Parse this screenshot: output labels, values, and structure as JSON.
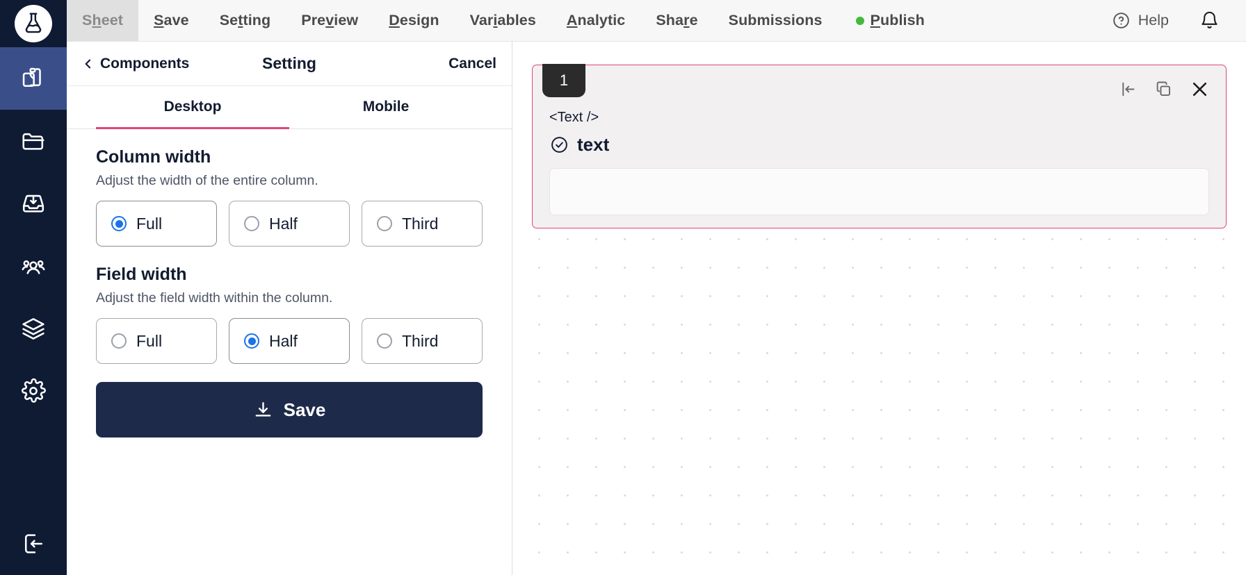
{
  "brand": {
    "logo_icon": "flask-logo-icon"
  },
  "sidebar": {
    "items": [
      {
        "name": "clipboard",
        "icon": "clipboard-icon",
        "active": true
      },
      {
        "name": "folder",
        "icon": "folder-icon",
        "active": false
      },
      {
        "name": "inbox",
        "icon": "inbox-download-icon",
        "active": false
      },
      {
        "name": "users",
        "icon": "users-icon",
        "active": false
      },
      {
        "name": "layers",
        "icon": "layers-icon",
        "active": false
      },
      {
        "name": "settings",
        "icon": "gear-icon",
        "active": false
      }
    ],
    "bottom": {
      "name": "logout",
      "icon": "logout-icon"
    }
  },
  "topbar": {
    "menu": [
      {
        "label": "Sheet",
        "accel_index": 1,
        "current": true
      },
      {
        "label": "Save",
        "accel_index": 0,
        "current": false
      },
      {
        "label": "Setting",
        "accel_index": 2,
        "current": false
      },
      {
        "label": "Preview",
        "accel_index": 3,
        "current": false
      },
      {
        "label": "Design",
        "accel_index": 0,
        "current": false
      },
      {
        "label": "Variables",
        "accel_index": 4,
        "current": false
      },
      {
        "label": "Analytic",
        "accel_index": 0,
        "current": false
      },
      {
        "label": "Share",
        "accel_index": 4,
        "current": false
      },
      {
        "label": "Submissions",
        "accel_index": -1,
        "current": false
      }
    ],
    "publish": {
      "label": "Publish",
      "accel_index": 0,
      "status_color": "#44b93c"
    },
    "help": {
      "label": "Help",
      "icon": "question-circle-icon"
    },
    "notifications": {
      "icon": "bell-icon"
    }
  },
  "panel": {
    "back_label": "Components",
    "back_icon": "chevron-left-icon",
    "title": "Setting",
    "cancel_label": "Cancel",
    "tabs": [
      {
        "label": "Desktop",
        "active": true
      },
      {
        "label": "Mobile",
        "active": false
      }
    ],
    "active_tab_color": "#e0457b",
    "sections": [
      {
        "title": "Column width",
        "description": "Adjust the width of the entire column.",
        "options": [
          {
            "label": "Full",
            "selected": true
          },
          {
            "label": "Half",
            "selected": false
          },
          {
            "label": "Third",
            "selected": false
          }
        ]
      },
      {
        "title": "Field width",
        "description": "Adjust the field width within the column.",
        "options": [
          {
            "label": "Full",
            "selected": false
          },
          {
            "label": "Half",
            "selected": true
          },
          {
            "label": "Third",
            "selected": false
          }
        ]
      }
    ],
    "save_button": {
      "label": "Save",
      "icon": "download-icon",
      "color": "#1e2a4a"
    },
    "radio_selected_color": "#1a73e8"
  },
  "canvas": {
    "card": {
      "badge": "1",
      "tag": "<Text />",
      "field_label": "text",
      "field_icon": "check-circle-icon",
      "input_value": "",
      "input_placeholder": "",
      "border_color": "#e0457b",
      "actions": [
        {
          "name": "insert-icon"
        },
        {
          "name": "duplicate-icon"
        },
        {
          "name": "close-icon"
        }
      ]
    }
  }
}
